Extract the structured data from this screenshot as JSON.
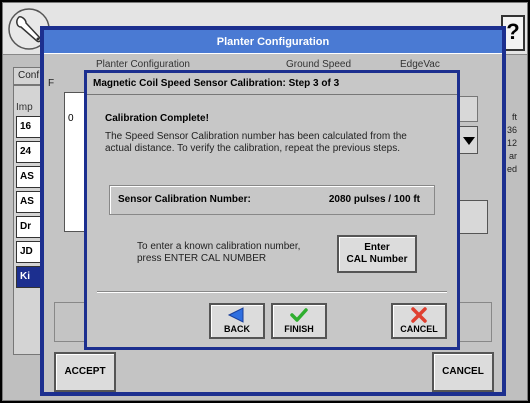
{
  "app": {
    "help_label": "?",
    "bg_tab_label": "Conf",
    "bg_list_caption": "Imp",
    "bg_list_items": [
      "16",
      "24",
      "AS",
      "AS",
      "Dr",
      "JD",
      "Ki"
    ],
    "bg_right_values": [
      "ft",
      "36",
      "12",
      "ar",
      "ed"
    ]
  },
  "planter_config": {
    "title": "Planter Configuration",
    "tabs": [
      "Planter Configuration",
      "Ground Speed",
      "EdgeVac"
    ],
    "field_label": "F",
    "field_value": "0",
    "accept_label": "ACCEPT",
    "cancel_label": "CANCEL"
  },
  "calibration": {
    "title": "Magnetic Coil Speed Sensor Calibration:  Step 3 of 3",
    "heading": "Calibration Complete!",
    "description": "The Speed Sensor Calibration number has been calculated from the actual distance.  To verify the calibration, repeat the previous steps.",
    "number_label": "Sensor Calibration Number:",
    "number_value": "2080 pulses / 100 ft",
    "enter_text": "To enter a known calibration number, press ENTER CAL NUMBER",
    "enter_btn_line1": "Enter",
    "enter_btn_line2": "CAL Number",
    "back_label": "BACK",
    "finish_label": "FINISH",
    "cancel_label": "CANCEL"
  },
  "colors": {
    "dialog_border": "#1c2f8f",
    "title_bar": "#4a7ad3",
    "back_arrow": "#2f6fe0",
    "finish_check": "#2fae2f",
    "cancel_x": "#e04030"
  }
}
